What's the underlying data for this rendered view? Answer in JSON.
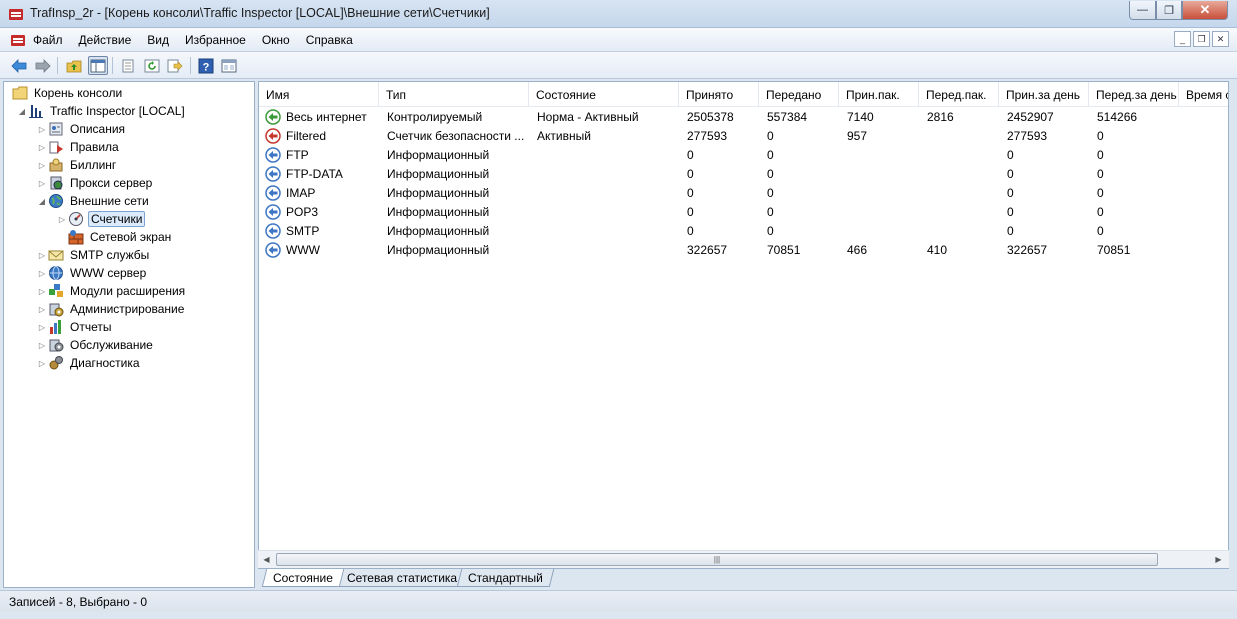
{
  "window": {
    "title": "TrafInsp_2r - [Корень консоли\\Traffic Inspector [LOCAL]\\Внешние сети\\Счетчики]",
    "controls": {
      "minimize": "—",
      "maximize": "❐",
      "close": "✕"
    }
  },
  "menu": {
    "items": [
      {
        "label": "Файл"
      },
      {
        "label": "Действие"
      },
      {
        "label": "Вид"
      },
      {
        "label": "Избранное"
      },
      {
        "label": "Окно"
      },
      {
        "label": "Справка"
      }
    ],
    "mdi_controls": [
      "_",
      "❐",
      "✕"
    ]
  },
  "toolbar": {
    "buttons": [
      "back-arrow-icon",
      "forward-arrow-icon",
      "up-folder-icon",
      "show-hide-tree-icon",
      "properties-icon",
      "refresh-icon",
      "export-list-icon",
      "help-icon",
      "console-view-icon"
    ]
  },
  "tree": {
    "root": "Корень консоли",
    "server": "Traffic Inspector [LOCAL]",
    "items": [
      {
        "label": "Описания",
        "icon": "descriptions-icon"
      },
      {
        "label": "Правила",
        "icon": "rules-icon"
      },
      {
        "label": "Биллинг",
        "icon": "billing-icon"
      },
      {
        "label": "Прокси сервер",
        "icon": "proxy-server-icon"
      },
      {
        "label": "Внешние сети",
        "icon": "external-networks-icon"
      },
      {
        "label": "Счетчики",
        "icon": "counters-icon"
      },
      {
        "label": "Сетевой экран",
        "icon": "firewall-icon"
      },
      {
        "label": "SMTP службы",
        "icon": "smtp-services-icon"
      },
      {
        "label": "WWW сервер",
        "icon": "www-server-icon"
      },
      {
        "label": "Модули расширения",
        "icon": "extension-modules-icon"
      },
      {
        "label": "Администрирование",
        "icon": "administration-icon"
      },
      {
        "label": "Отчеты",
        "icon": "reports-icon"
      },
      {
        "label": "Обслуживание",
        "icon": "maintenance-icon"
      },
      {
        "label": "Диагностика",
        "icon": "diagnostics-icon"
      }
    ]
  },
  "list": {
    "columns": [
      "Имя",
      "Тип",
      "Состояние",
      "Принято",
      "Передано",
      "Прин.пак.",
      "Перед.пак.",
      "Прин.за день",
      "Перед.за день",
      "Время с"
    ],
    "rows": [
      {
        "icon": "green-arrow-icon",
        "cells": [
          "Весь интернет",
          "Контролируемый",
          "Норма - Активный",
          "2505378",
          "557384",
          "7140",
          "2816",
          "2452907",
          "514266"
        ]
      },
      {
        "icon": "red-arrow-icon",
        "cells": [
          "Filtered",
          "Счетчик безопасности ...",
          "Активный",
          "277593",
          "0",
          "957",
          "",
          "277593",
          "0"
        ]
      },
      {
        "icon": "blue-arrow-icon",
        "cells": [
          "FTP",
          "Информационный",
          "",
          "0",
          "0",
          "",
          "",
          "0",
          "0"
        ]
      },
      {
        "icon": "blue-arrow-icon",
        "cells": [
          "FTP-DATA",
          "Информационный",
          "",
          "0",
          "0",
          "",
          "",
          "0",
          "0"
        ]
      },
      {
        "icon": "blue-arrow-icon",
        "cells": [
          "IMAP",
          "Информационный",
          "",
          "0",
          "0",
          "",
          "",
          "0",
          "0"
        ]
      },
      {
        "icon": "blue-arrow-icon",
        "cells": [
          "POP3",
          "Информационный",
          "",
          "0",
          "0",
          "",
          "",
          "0",
          "0"
        ]
      },
      {
        "icon": "blue-arrow-icon",
        "cells": [
          "SMTP",
          "Информационный",
          "",
          "0",
          "0",
          "",
          "",
          "0",
          "0"
        ]
      },
      {
        "icon": "blue-arrow-icon",
        "cells": [
          "WWW",
          "Информационный",
          "",
          "322657",
          "70851",
          "466",
          "410",
          "322657",
          "70851"
        ]
      }
    ]
  },
  "scrollbar": {
    "grip": "|||"
  },
  "tabs": [
    "Состояние",
    "Сетевая статистика",
    "Стандартный"
  ],
  "status": {
    "text": "Записей - 8,    Выбрано - 0"
  },
  "colors": {
    "accent": "#3a6fb5",
    "selection": "#dcebfc",
    "green": "#3a9a3a",
    "red": "#c8372d",
    "blue": "#3c76c4"
  }
}
